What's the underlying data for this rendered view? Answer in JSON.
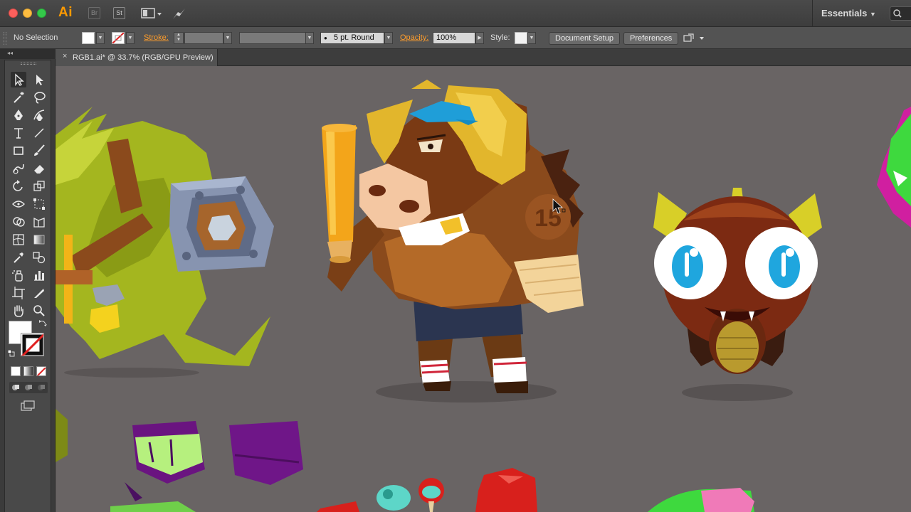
{
  "app": {
    "name": "Ai",
    "bridge_label": "Br",
    "stock_label": "St",
    "workspace": "Essentials"
  },
  "control_bar": {
    "selection": "No Selection",
    "stroke_label": "Stroke:",
    "brush": "5 pt. Round",
    "opacity_label": "Opacity:",
    "opacity_value": "100%",
    "style_label": "Style:",
    "document_setup": "Document Setup",
    "preferences": "Preferences"
  },
  "document": {
    "tab_title": "RGB1.ai* @ 33.7% (RGB/GPU Preview)",
    "close_label": "×",
    "jersey_number": "15"
  },
  "colors": {
    "canvas": "#696464",
    "accent_orange": "#ff9d2b",
    "panel": "#494949"
  }
}
